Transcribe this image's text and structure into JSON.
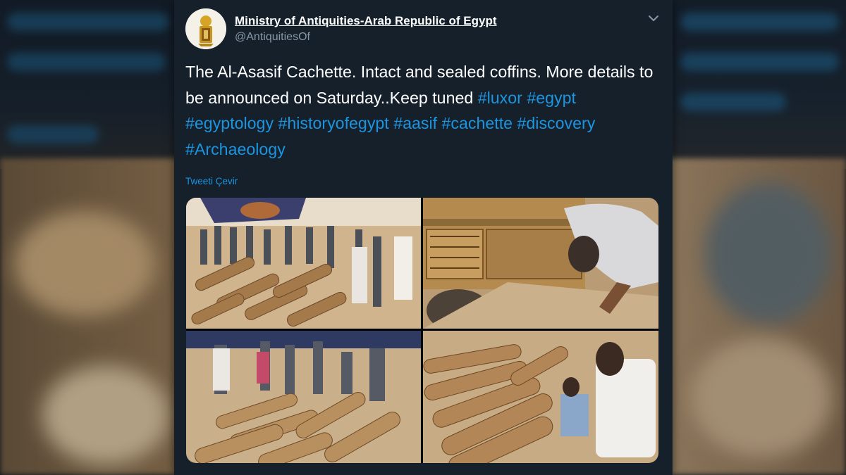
{
  "account": {
    "display_name": "Ministry of Antiquities-Arab Republic of Egypt",
    "handle": "@AntiquitiesOf"
  },
  "tweet": {
    "text": "The Al-Asasif Cachette. Intact and sealed coffins. More details to be announced on Saturday..Keep tuned",
    "hashtags_line": "#luxor #egypt #egyptology #historyofegypt #aasif #cachette #discovery #Archaeology",
    "hashtags": [
      "#luxor",
      "#egypt",
      "#egyptology",
      "#historyofegypt",
      "#aasif",
      "#cachette",
      "#discovery",
      "#Archaeology"
    ],
    "translate_label": "Tweeti Çevir"
  },
  "icons": {
    "more": "chevron-down-icon",
    "avatar": "ministry-emblem"
  },
  "colors": {
    "card_background": "#15202b",
    "text": "#ffffff",
    "secondary_text": "#8899a6",
    "link": "#1b95e0"
  },
  "media": {
    "photo_count": 4
  }
}
